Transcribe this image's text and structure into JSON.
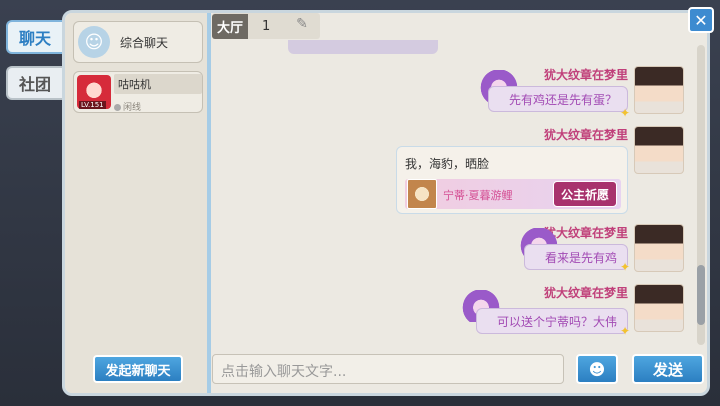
{
  "tabs": {
    "chat": "聊天",
    "guild": "社团"
  },
  "conversations": {
    "public_label": "综合聊天",
    "user_name": "咕咕机",
    "user_level": "LV.151",
    "user_status": "闲线"
  },
  "new_chat_label": "发起新聊天",
  "header": {
    "hall": "大厅",
    "hall_number": "1"
  },
  "messages": [
    {
      "sender": "犹大纹章在梦里",
      "text": "先有鸡还是先有蛋？"
    },
    {
      "sender": "犹大纹章在梦里",
      "text": "我，海豹，晒脸",
      "gacha_name": "宁蒂·夏暮游鲤",
      "gacha_button": "公主祈愿"
    },
    {
      "sender": "犹大纹章在梦里",
      "text": "看来是先有鸡"
    },
    {
      "sender": "犹大纹章在梦里",
      "text": "可以送个宁蒂吗？大伟"
    }
  ],
  "input": {
    "placeholder": "点击输入聊天文字..."
  },
  "send_label": "发送",
  "colors": {
    "accent": "#2c7fc1",
    "sender": "#c0407a",
    "bubble_text": "#a24ab4"
  }
}
